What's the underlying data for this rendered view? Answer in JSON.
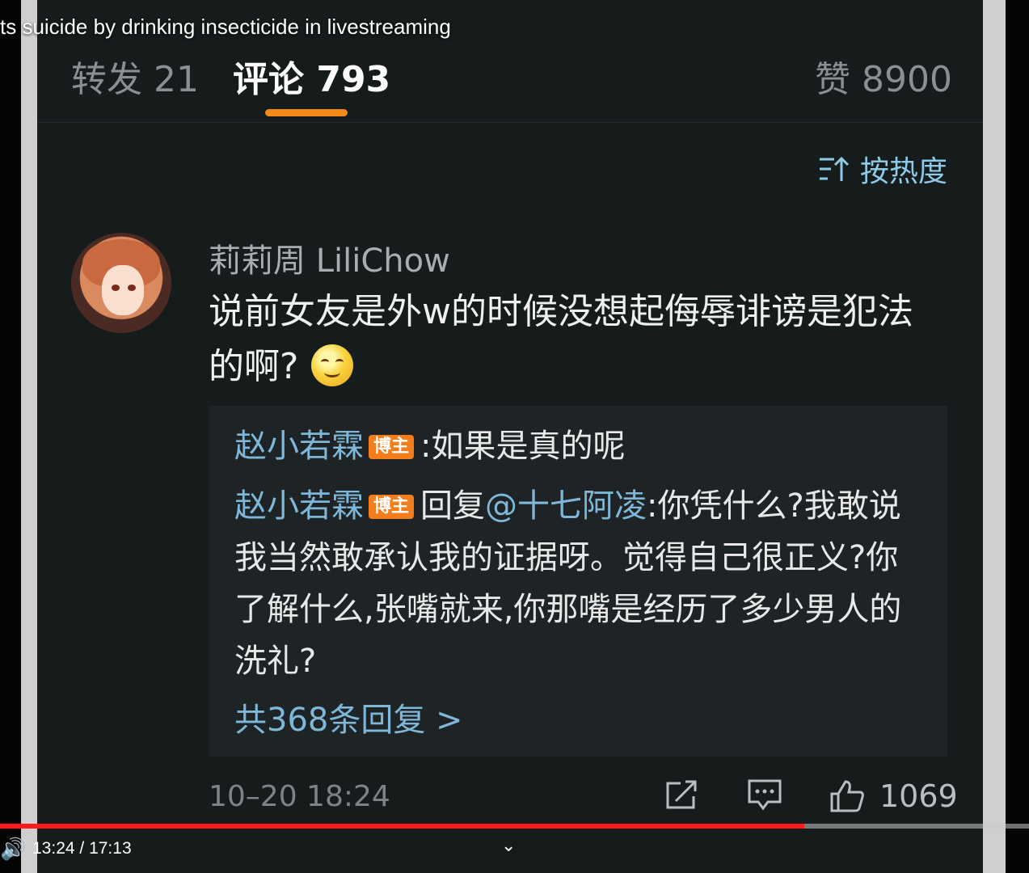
{
  "video": {
    "title": "ts suicide by drinking insecticide in livestreaming",
    "time_current": "13:24",
    "time_total": "17:13",
    "progress": 0.782
  },
  "tabs": {
    "repost_label": "转发",
    "repost_count": "21",
    "comments_label": "评论",
    "comments_count": "793",
    "likes_label": "赞",
    "likes_count": "8900"
  },
  "sort": {
    "label": "按热度"
  },
  "comment": {
    "username": "莉莉周 LiliChow",
    "text": "说前女友是外w的时候没想起侮辱诽谤是犯法的啊?",
    "timestamp": "10–20 18:24",
    "like_count": "1069"
  },
  "replies": [
    {
      "name": "赵小若霖",
      "badge": "博主",
      "text": ":如果是真的呢"
    },
    {
      "name": "赵小若霖",
      "badge": "博主",
      "prefix": "回复",
      "mention": "@十七阿凌",
      "text": ":你凭什么?我敢说我当然敢承认我的证据呀。觉得自己很正义?你了解什么,张嘴就来,你那嘴是经历了多少男人的洗礼?"
    }
  ],
  "more_replies": "共368条回复 >",
  "colors": {
    "accent": "#f28a1a",
    "link": "#7fb7d8",
    "progress": "#ff1a1a"
  }
}
